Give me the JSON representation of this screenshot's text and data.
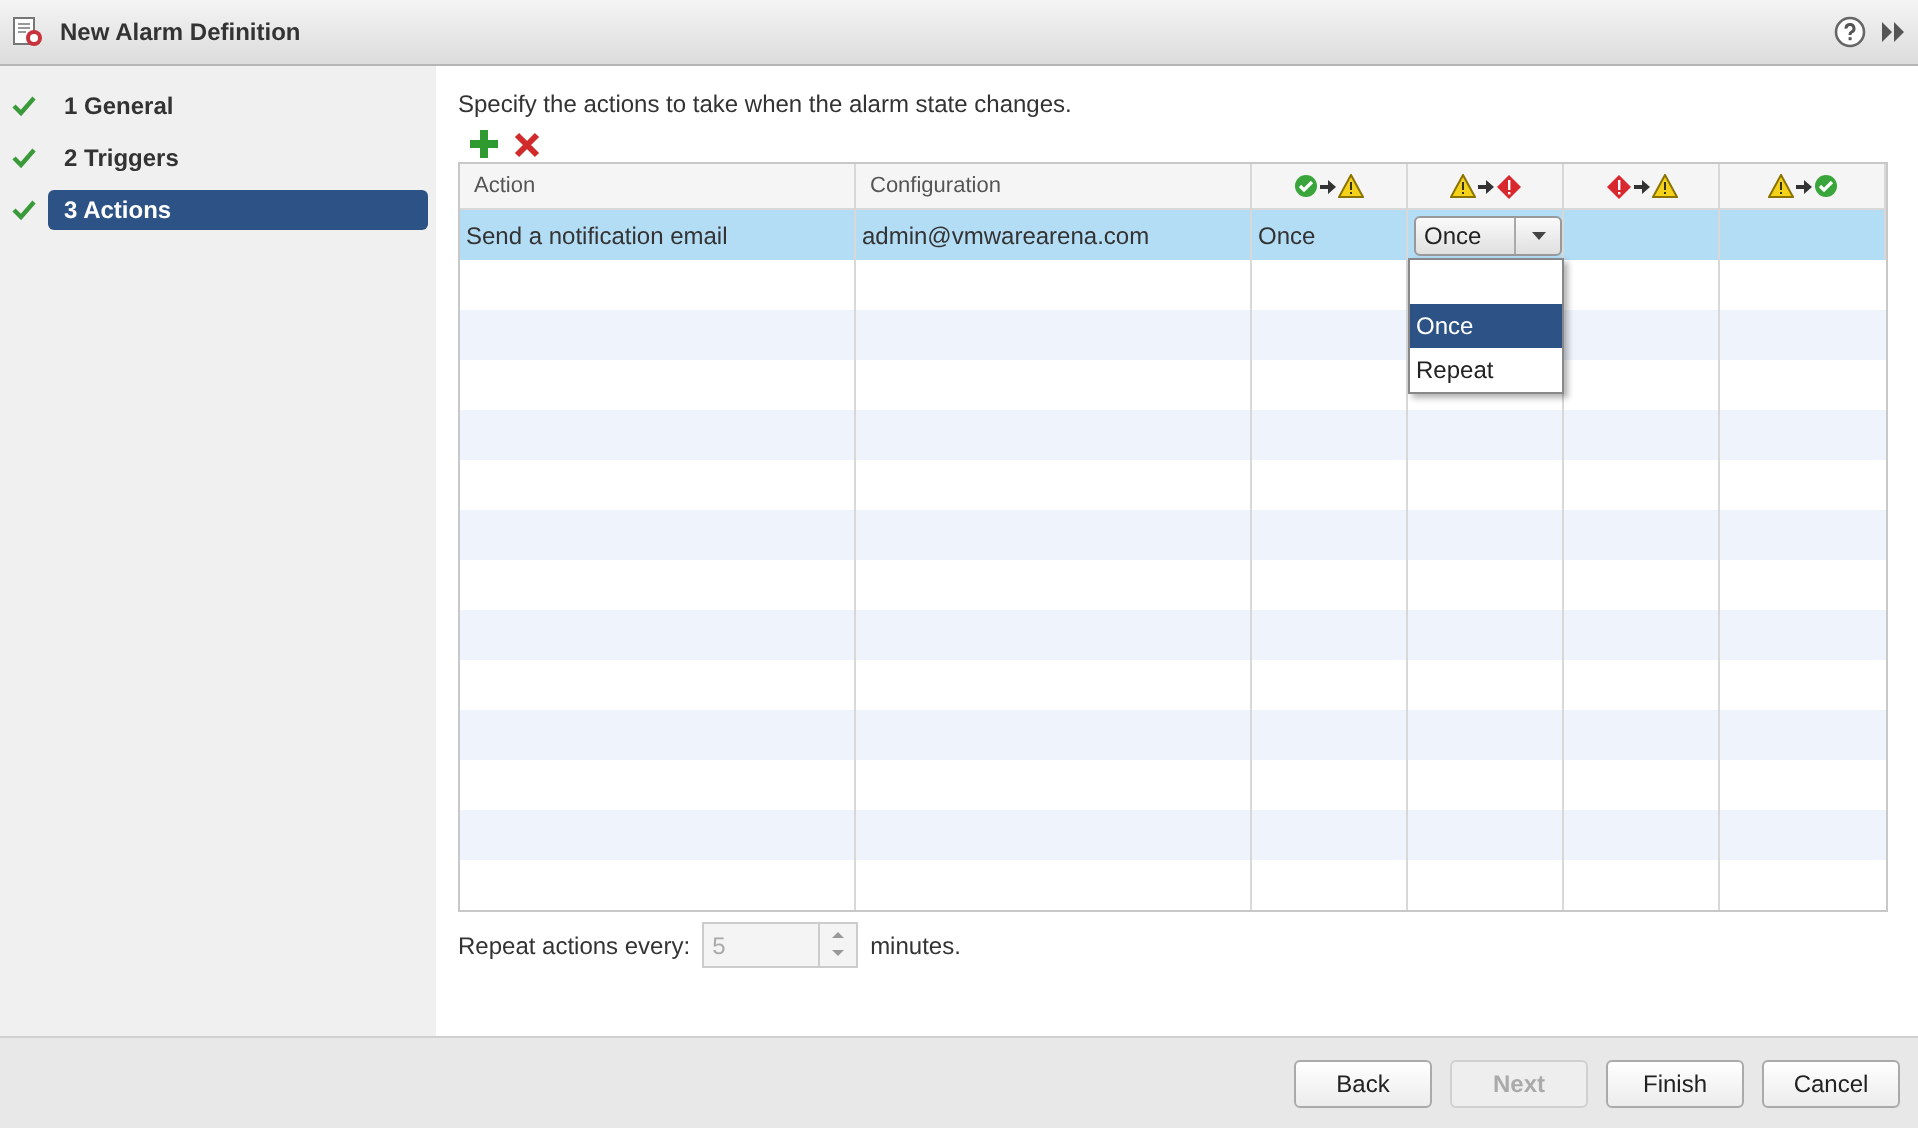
{
  "window": {
    "title": "New Alarm Definition"
  },
  "steps": [
    {
      "number": "1",
      "label": "General",
      "done": true,
      "selected": false
    },
    {
      "number": "2",
      "label": "Triggers",
      "done": true,
      "selected": false
    },
    {
      "number": "3",
      "label": "Actions",
      "done": true,
      "selected": true
    }
  ],
  "instruction": "Specify the actions to take when the alarm state changes.",
  "table": {
    "columns": [
      {
        "kind": "text",
        "label": "Action"
      },
      {
        "kind": "text",
        "label": "Configuration"
      },
      {
        "kind": "ok_to_warning"
      },
      {
        "kind": "warning_to_alert"
      },
      {
        "kind": "alert_to_warning"
      },
      {
        "kind": "warning_to_ok"
      }
    ],
    "rows": [
      {
        "selected": true,
        "cells": [
          {
            "kind": "text",
            "text": "Send a notification email"
          },
          {
            "kind": "text",
            "text": "admin@vmwarearena.com"
          },
          {
            "kind": "text",
            "text": "Once"
          },
          {
            "kind": "combo",
            "value": "Once",
            "expanded": true,
            "options": [
              {
                "label": "Once",
                "selected": true
              },
              {
                "label": "Repeat",
                "selected": false
              }
            ]
          },
          {
            "kind": "empty"
          },
          {
            "kind": "empty"
          }
        ]
      }
    ]
  },
  "repeat": {
    "label": "Repeat actions every:",
    "placeholder": "5",
    "unit": "minutes.",
    "disabled": true
  },
  "buttons": [
    {
      "label": "Back",
      "disabled": false
    },
    {
      "label": "Next",
      "disabled": true
    },
    {
      "label": "Finish",
      "disabled": false
    },
    {
      "label": "Cancel",
      "disabled": false
    }
  ]
}
